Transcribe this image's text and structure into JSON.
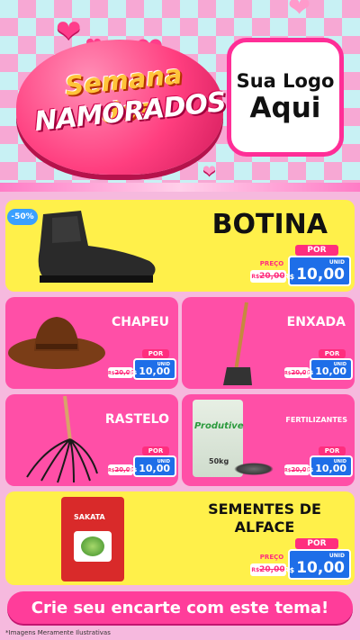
{
  "header": {
    "title_line1": "Semana dos",
    "title_line2": "NAMORADOS",
    "logo_line1": "Sua Logo",
    "logo_line2": "Aqui"
  },
  "badge": "-50%",
  "price_common": {
    "old_label": "PREÇO",
    "new_label": "POR",
    "unit": "UNID",
    "currency": "R$",
    "old_value": "20,00",
    "new_value": "10,00"
  },
  "products": [
    {
      "name": "BOTINA"
    },
    {
      "name": "CHAPEU"
    },
    {
      "name": "ENXADA"
    },
    {
      "name": "RASTELO"
    },
    {
      "name": "FERTILIZANTES",
      "bag_brand": "Produtive",
      "bag_weight": "50kg"
    },
    {
      "name": "SEMENTES DE ALFACE",
      "seed_brand": "SAKATA"
    }
  ],
  "footer": {
    "cta": "Crie seu encarte com este tema!",
    "disclaimer": "*Imagens Meramente Ilustrativas"
  }
}
